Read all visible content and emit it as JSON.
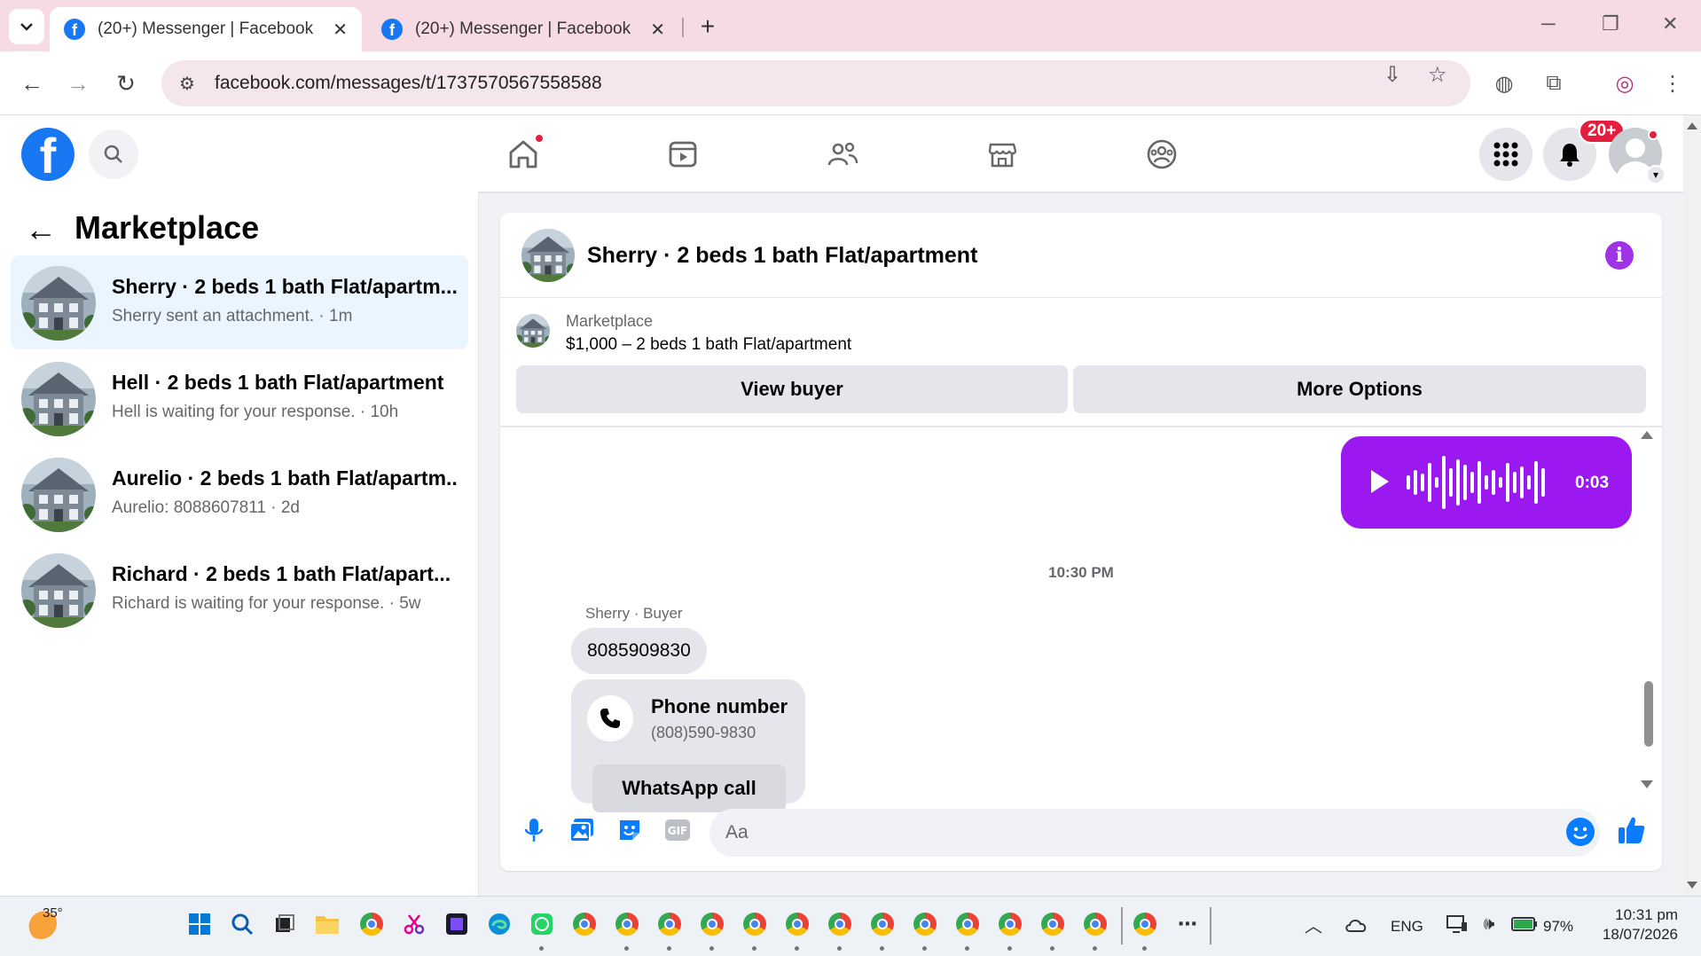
{
  "browser": {
    "tabs": [
      {
        "title": "(20+) Messenger | Facebook",
        "active": true
      },
      {
        "title": "(20+) Messenger | Facebook",
        "active": false
      }
    ],
    "url": "facebook.com/messages/t/1737570567558588"
  },
  "fb_header": {
    "notification_count": "20+"
  },
  "sidebar": {
    "title": "Marketplace",
    "conversations": [
      {
        "title": "Sherry · 2 beds 1 bath Flat/apartm...",
        "subtitle": "Sherry sent an attachment. · 1m",
        "selected": true
      },
      {
        "title": "Hell · 2 beds 1 bath Flat/apartment",
        "subtitle": "Hell is waiting for your response. · 10h",
        "selected": false
      },
      {
        "title": "Aurelio · 2 beds 1 bath Flat/apartm...",
        "subtitle": "Aurelio: 8088607811 · 2d",
        "selected": false
      },
      {
        "title": "Richard · 2 beds 1 bath Flat/apart...",
        "subtitle": "Richard is waiting for your response. · 5w",
        "selected": false
      }
    ]
  },
  "chat": {
    "title": "Sherry · 2 beds 1 bath Flat/apartment",
    "listing": {
      "label": "Marketplace",
      "item": "$1,000 – 2 beds 1 bath Flat/apartment",
      "view_buyer": "View buyer",
      "more_options": "More Options"
    },
    "voice_message": {
      "duration": "0:03"
    },
    "time_separator": "10:30 PM",
    "sender_label": "Sherry · Buyer",
    "message_text": "8085909830",
    "phone_card": {
      "title": "Phone number",
      "number": "(808)590-9830",
      "action": "WhatsApp call"
    },
    "composer": {
      "placeholder": "Aa"
    }
  },
  "taskbar": {
    "temperature": "35°",
    "language": "ENG",
    "battery": "97%",
    "time": "10:31 pm",
    "date": "18/07/2026"
  },
  "colors": {
    "fb_blue": "#1877f2",
    "messenger_purple": "#9b18f0",
    "selected_bg": "#ebf5ff",
    "notification_red": "#e41e3f"
  }
}
